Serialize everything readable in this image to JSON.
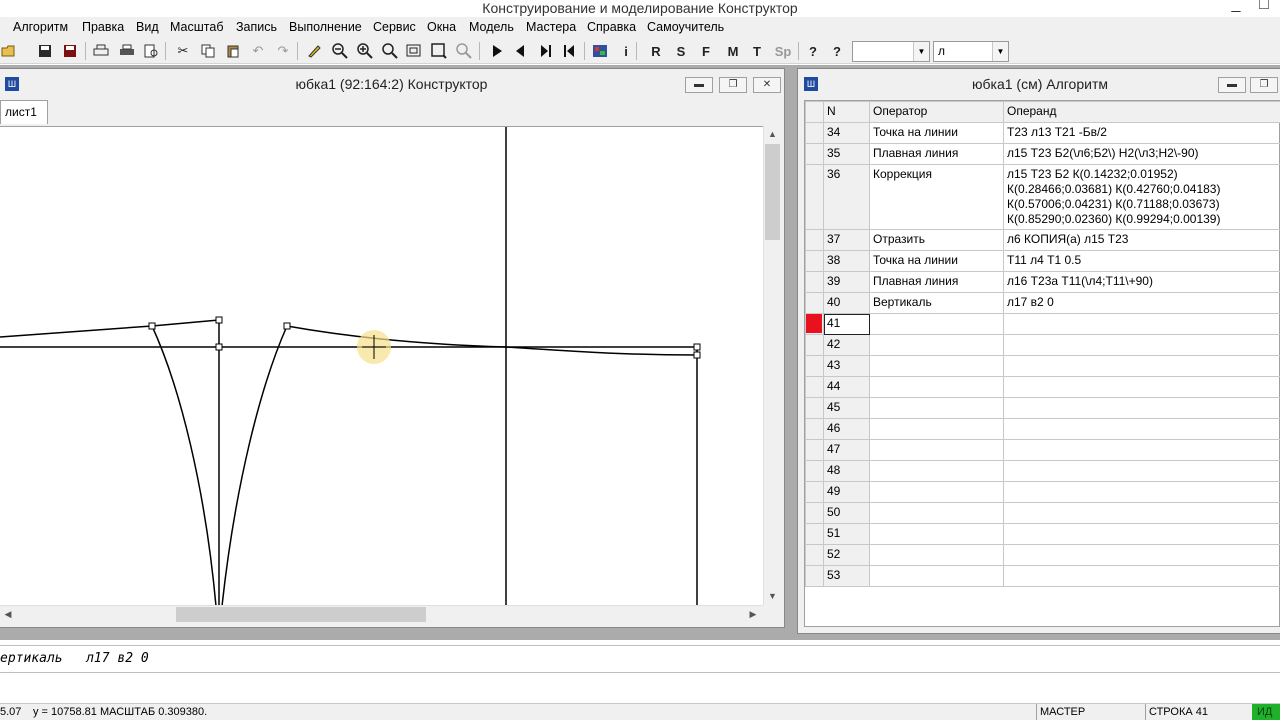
{
  "app": {
    "title": "Конструирование и моделирование  Конструктор",
    "window_controls": [
      "_",
      "□"
    ]
  },
  "menu": [
    "Алгоритм",
    "Правка",
    "Вид",
    "Масштаб",
    "Запись",
    "Выполнение",
    "Сервис",
    "Окна",
    "Модель",
    "Мастера",
    "Справка",
    "Самоучитель"
  ],
  "toolbar": {
    "letters": [
      "R",
      "S",
      "F",
      "M",
      "T",
      "Sp"
    ],
    "combo1_value": "",
    "combo2_value": "л"
  },
  "left_window": {
    "title": "юбка1 (92:164:2) Конструктор",
    "sheet_tab": "лист1"
  },
  "right_window": {
    "title": "юбка1 (см) Алгоритм",
    "columns": [
      "N",
      "Оператор",
      "Операнд"
    ],
    "rows": [
      {
        "n": "34",
        "op": "Точка на линии",
        "arg": "Т23 л13 Т21 -Бв/2"
      },
      {
        "n": "35",
        "op": "Плавная линия",
        "arg": "л15 Т23 Б2(\\л6;Б2\\) Н2(\\л3;Н2\\-90)"
      },
      {
        "n": "36",
        "op": "Коррекция",
        "arg": "л15 Т23 Б2 К(0.14232;0.01952) К(0.28466;0.03681) К(0.42760;0.04183) К(0.57006;0.04231) К(0.71188;0.03673) К(0.85290;0.02360) К(0.99294;0.00139)"
      },
      {
        "n": "37",
        "op": "Отразить",
        "arg": "л6 КОПИЯ(а) л15 Т23"
      },
      {
        "n": "38",
        "op": "Точка на линии",
        "arg": "Т11 л4 Т1 0.5"
      },
      {
        "n": "39",
        "op": "Плавная линия",
        "arg": "л16 Т23а Т11(\\л4;Т11\\+90)"
      },
      {
        "n": "40",
        "op": "Вертикаль",
        "arg": "л17 в2 0"
      },
      {
        "n": "41",
        "op": "",
        "arg": ""
      },
      {
        "n": "42",
        "op": "",
        "arg": ""
      },
      {
        "n": "43",
        "op": "",
        "arg": ""
      },
      {
        "n": "44",
        "op": "",
        "arg": ""
      },
      {
        "n": "45",
        "op": "",
        "arg": ""
      },
      {
        "n": "46",
        "op": "",
        "arg": ""
      },
      {
        "n": "47",
        "op": "",
        "arg": ""
      },
      {
        "n": "48",
        "op": "",
        "arg": ""
      },
      {
        "n": "49",
        "op": "",
        "arg": ""
      },
      {
        "n": "50",
        "op": "",
        "arg": ""
      },
      {
        "n": "51",
        "op": "",
        "arg": ""
      },
      {
        "n": "52",
        "op": "",
        "arg": ""
      },
      {
        "n": "53",
        "op": "",
        "arg": ""
      }
    ],
    "current_row": "41",
    "marker_color": "#e8121e"
  },
  "command_line": "ертикаль   л17 в2 0",
  "status": {
    "coord_x": "5.07",
    "coord_y_scale": "y = 10758.81 МАСШТАБ 0.309380.",
    "mode": "МАСТЕР",
    "row": "СТРОКА 41",
    "state": "ИД"
  }
}
